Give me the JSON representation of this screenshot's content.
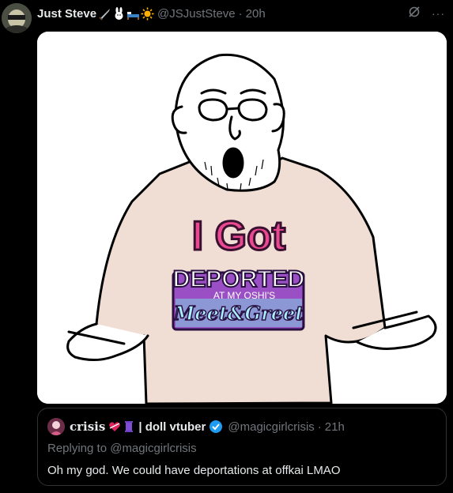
{
  "tweet": {
    "display_name": "Just Steve",
    "handle": "@JSJustSteve",
    "separator": "·",
    "time": "20h",
    "name_emojis": [
      "sword-icon",
      "rabbit-icon",
      "bed-icon",
      "sun-icon"
    ],
    "header_icons": [
      "grok-icon",
      "more-icon"
    ],
    "more_label": "···"
  },
  "media": {
    "shirt_line1": "I Got",
    "shirt_line2": "DEPORTED",
    "shirt_line3": "AT MY OSHI'S",
    "shirt_line4": "Meet&Greet"
  },
  "quote": {
    "display_name": "crisis",
    "badges": [
      "heart-icon",
      "spool-icon"
    ],
    "name_suffix": "| doll vtuber",
    "handle": "@magicgirlcrisis",
    "separator": "·",
    "time": "21h",
    "replying_to": "Replying to @magicgirlcrisis",
    "text": "Oh my god. We could have deportations at offkai LMAO"
  },
  "colors": {
    "background": "#000000",
    "text_primary": "#e7e9ea",
    "text_secondary": "#71767b",
    "verified": "#1d9bf0",
    "border": "#2f3336"
  }
}
